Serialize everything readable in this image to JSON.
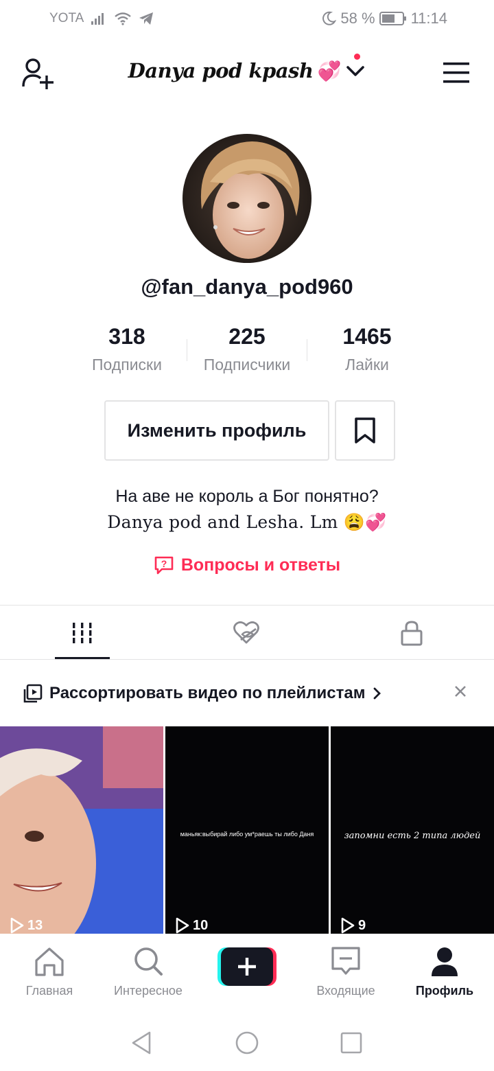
{
  "status_bar": {
    "carrier": "YOTA",
    "battery_percent": "58 %",
    "time": "11:14"
  },
  "header": {
    "account_name": "Danya pod kpash",
    "account_emoji": "💞"
  },
  "profile": {
    "username": "@fan_danya_pod960",
    "stats": [
      {
        "value": "318",
        "label": "Подписки"
      },
      {
        "value": "225",
        "label": "Подписчики"
      },
      {
        "value": "1465",
        "label": "Лайки"
      }
    ],
    "edit_button_label": "Изменить профиль",
    "bio_line1": "На аве не король а Бог понятно?",
    "bio_line2": "Danya pod and  Lesha. Lm 😩💞",
    "qa_label": "Вопросы и ответы"
  },
  "playlist_banner": {
    "text": "Рассортировать видео по плейлистам"
  },
  "videos": [
    {
      "caption": "",
      "views": "13"
    },
    {
      "caption": "маньяк:выбирай либо ум*раешь ты либо Даня",
      "views": "10"
    },
    {
      "caption": "запомни есть 2 типа людей",
      "views": "9"
    }
  ],
  "bottom_nav": [
    {
      "label": "Главная"
    },
    {
      "label": "Интересное"
    },
    {
      "label": "Входящие"
    },
    {
      "label": "Профиль"
    }
  ],
  "colors": {
    "accent": "#fe2c55",
    "cyan": "#25f4ee",
    "text": "#161823",
    "muted": "#8a8b91",
    "border": "#e3e3e4"
  }
}
